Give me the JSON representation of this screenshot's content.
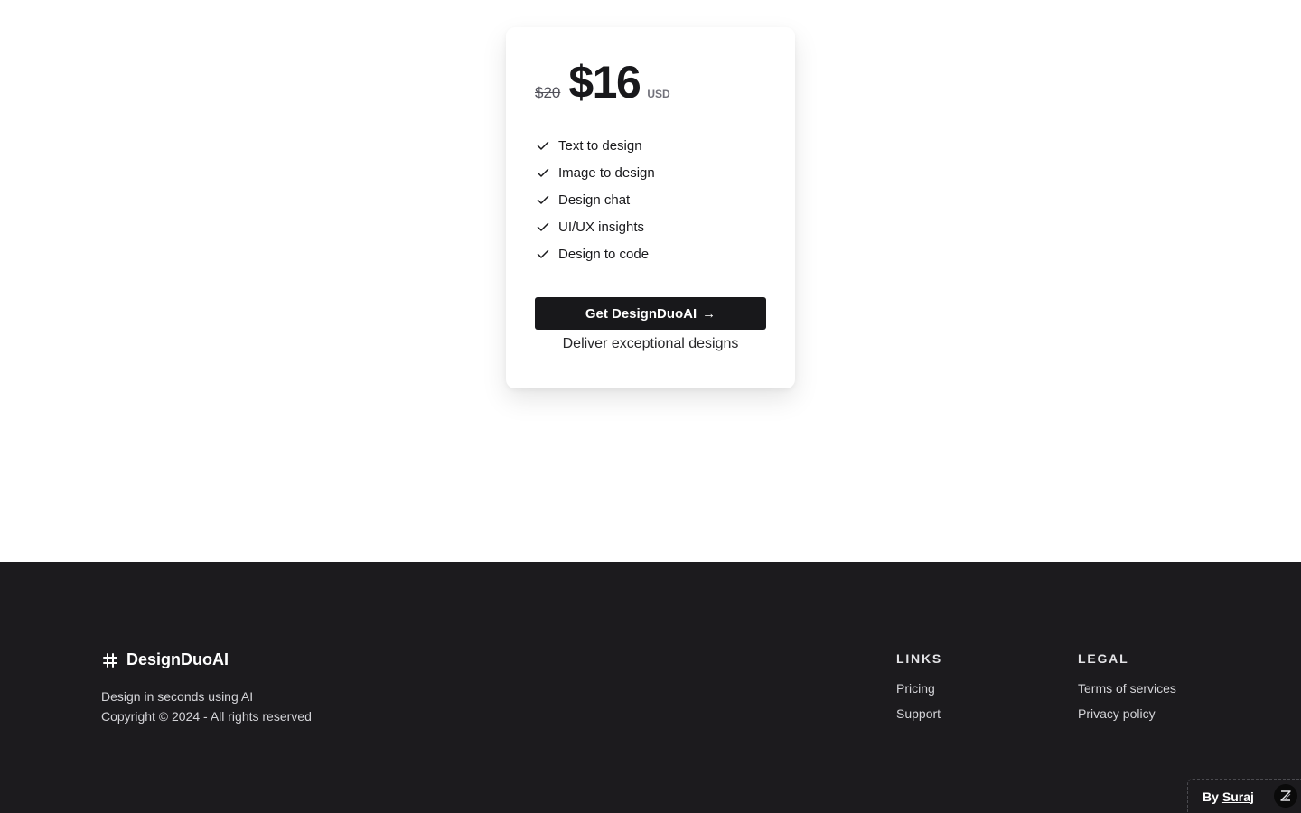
{
  "pricing": {
    "old_price": "$20",
    "price": "$16",
    "currency": "USD",
    "features": [
      {
        "label": "Text to design",
        "icon": "check-icon"
      },
      {
        "label": "Image to design",
        "icon": "check-icon"
      },
      {
        "label": "Design chat",
        "icon": "check-icon"
      },
      {
        "label": "UI/UX insights",
        "icon": "check-icon"
      },
      {
        "label": "Design to code",
        "icon": "check-icon"
      }
    ],
    "cta_label": "Get DesignDuoAI",
    "cta_icon": "arrow-right-icon",
    "tagline": "Deliver exceptional designs"
  },
  "footer": {
    "brand": {
      "name": "DesignDuoAI",
      "icon": "hash-icon",
      "description": "Design in seconds using AI",
      "copyright": "Copyright © 2024 - All rights reserved"
    },
    "links": {
      "title": "LINKS",
      "items": [
        "Pricing",
        "Support"
      ]
    },
    "legal": {
      "title": "LEGAL",
      "items": [
        "Terms of services",
        "Privacy policy"
      ]
    },
    "byline": {
      "prefix": "By",
      "name": "Suraj",
      "logo_icon": "z-logo-icon"
    }
  },
  "colors": {
    "background": "#ffffff",
    "footer_background": "#1c1b1e",
    "button_background": "#18181b",
    "text_primary": "#18181b"
  }
}
